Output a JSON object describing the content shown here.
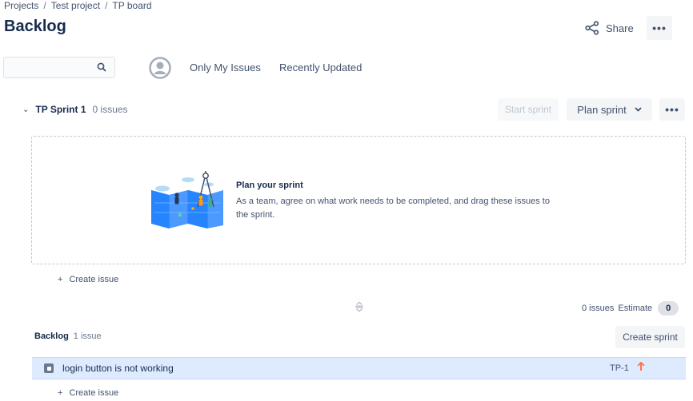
{
  "breadcrumb": {
    "items": [
      "Projects",
      "Test project",
      "TP board"
    ],
    "separator": "/"
  },
  "page": {
    "title": "Backlog"
  },
  "header": {
    "share_label": "Share",
    "more_label": "•••"
  },
  "filters": {
    "search_placeholder": "",
    "only_my_issues": "Only My Issues",
    "recently_updated": "Recently Updated"
  },
  "sprint": {
    "name": "TP Sprint 1",
    "count": "0 issues",
    "start_label": "Start sprint",
    "plan_label": "Plan sprint",
    "more_label": "•••",
    "empty_title": "Plan your sprint",
    "empty_desc": "As a team, agree on what work needs to be completed, and drag these issues to the sprint.",
    "create_issue": "Create issue",
    "summary_count": "0 issues",
    "estimate_label": "Estimate",
    "estimate_value": "0"
  },
  "backlog": {
    "name": "Backlog",
    "count": "1 issue",
    "create_sprint_label": "Create sprint",
    "create_issue": "Create issue",
    "issues": [
      {
        "summary": "login button is not working",
        "key": "TP-1",
        "priority": "high"
      }
    ]
  },
  "colors": {
    "text": "#172b4d",
    "subtle": "#42526e",
    "selected_row": "#deebff",
    "priority_high": "#ff7452",
    "button_bg": "#f4f5f7"
  }
}
